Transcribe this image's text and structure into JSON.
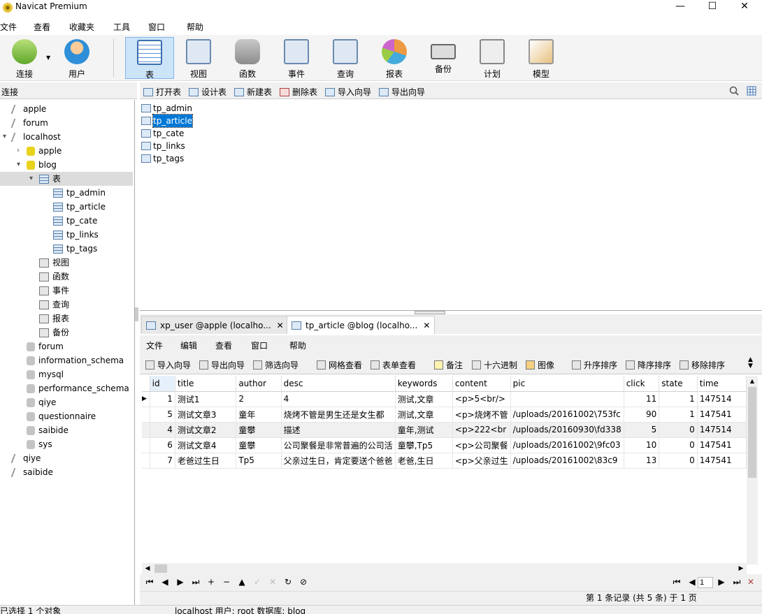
{
  "window": {
    "title": "Navicat Premium",
    "minimize": "—",
    "maximize": "☐",
    "close": "✕"
  },
  "menu": [
    "文件",
    "查看",
    "收藏夹",
    "工具",
    "窗口",
    "帮助"
  ],
  "toolbar": [
    {
      "label": "连接",
      "icon": "connect-icon"
    },
    {
      "label": "用户",
      "icon": "user-icon"
    },
    {
      "label": "表",
      "icon": "table-icon"
    },
    {
      "label": "视图",
      "icon": "view-icon"
    },
    {
      "label": "函数",
      "icon": "function-icon"
    },
    {
      "label": "事件",
      "icon": "event-icon"
    },
    {
      "label": "查询",
      "icon": "query-icon"
    },
    {
      "label": "报表",
      "icon": "report-icon"
    },
    {
      "label": "备份",
      "icon": "backup-icon"
    },
    {
      "label": "计划",
      "icon": "schedule-icon"
    },
    {
      "label": "模型",
      "icon": "model-icon"
    }
  ],
  "conn_header": "连接",
  "object_toolbar": [
    "打开表",
    "设计表",
    "新建表",
    "删除表",
    "导入向导",
    "导出向导"
  ],
  "tree": [
    {
      "label": "apple",
      "level": 0,
      "icon": "connection-icon"
    },
    {
      "label": "forum",
      "level": 0,
      "icon": "connection-icon"
    },
    {
      "label": "localhost",
      "level": 0,
      "icon": "connection-icon",
      "expanded": true
    },
    {
      "label": "apple",
      "level": 1,
      "icon": "database-icon",
      "collapsed": true
    },
    {
      "label": "blog",
      "level": 1,
      "icon": "database-icon",
      "expanded": true
    },
    {
      "label": "表",
      "level": 2,
      "icon": "tables-icon",
      "expanded": true,
      "selected": true
    },
    {
      "label": "tp_admin",
      "level": 3,
      "icon": "table-icon"
    },
    {
      "label": "tp_article",
      "level": 3,
      "icon": "table-icon"
    },
    {
      "label": "tp_cate",
      "level": 3,
      "icon": "table-icon"
    },
    {
      "label": "tp_links",
      "level": 3,
      "icon": "table-icon"
    },
    {
      "label": "tp_tags",
      "level": 3,
      "icon": "table-icon"
    },
    {
      "label": "视图",
      "level": 2,
      "icon": "view-icon"
    },
    {
      "label": "函数",
      "level": 2,
      "icon": "function-icon"
    },
    {
      "label": "事件",
      "level": 2,
      "icon": "event-icon"
    },
    {
      "label": "查询",
      "level": 2,
      "icon": "query-icon"
    },
    {
      "label": "报表",
      "level": 2,
      "icon": "report-icon"
    },
    {
      "label": "备份",
      "level": 2,
      "icon": "backup-icon"
    },
    {
      "label": "forum",
      "level": 1,
      "icon": "database-icon"
    },
    {
      "label": "information_schema",
      "level": 1,
      "icon": "database-icon"
    },
    {
      "label": "mysql",
      "level": 1,
      "icon": "database-icon"
    },
    {
      "label": "performance_schema",
      "level": 1,
      "icon": "database-icon"
    },
    {
      "label": "qiye",
      "level": 1,
      "icon": "database-icon"
    },
    {
      "label": "questionnaire",
      "level": 1,
      "icon": "database-icon"
    },
    {
      "label": "saibide",
      "level": 1,
      "icon": "database-icon"
    },
    {
      "label": "sys",
      "level": 1,
      "icon": "database-icon"
    },
    {
      "label": "qiye",
      "level": 0,
      "icon": "connection-icon"
    },
    {
      "label": "saibide",
      "level": 0,
      "icon": "connection-icon"
    }
  ],
  "object_list": [
    {
      "label": "tp_admin",
      "selected": false
    },
    {
      "label": "tp_article",
      "selected": true
    },
    {
      "label": "tp_cate",
      "selected": false
    },
    {
      "label": "tp_links",
      "selected": false
    },
    {
      "label": "tp_tags",
      "selected": false
    }
  ],
  "doc_tabs": [
    {
      "label": "xp_user @apple (localho...",
      "active": false
    },
    {
      "label": "tp_article @blog (localho...",
      "active": true
    }
  ],
  "doc_menu": [
    "文件",
    "编辑",
    "查看",
    "窗口",
    "帮助"
  ],
  "doc_tools": [
    "导入向导",
    "导出向导",
    "筛选向导",
    "网格查看",
    "表单查看",
    "备注",
    "十六进制",
    "图像",
    "升序排序",
    "降序排序",
    "移除排序"
  ],
  "grid": {
    "columns": [
      "id",
      "title",
      "author",
      "desc",
      "keywords",
      "content",
      "pic",
      "click",
      "state",
      "time"
    ],
    "rows": [
      [
        "1",
        "测试1",
        "2",
        "4",
        "测试,文章",
        "<p>5<br/>",
        "",
        "11",
        "1",
        "147514"
      ],
      [
        "5",
        "测试文章3",
        "童年",
        "烧烤不管是男生还是女生都",
        "测试,文章",
        "<p>烧烤不管",
        "/uploads/20161002\\753fc",
        "90",
        "1",
        "147541"
      ],
      [
        "4",
        "测试文章2",
        "童攀",
        "描述",
        "童年,测试",
        "<p>222<br",
        "/uploads/20160930\\fd338",
        "5",
        "0",
        "147514"
      ],
      [
        "6",
        "测试文章4",
        "童攀",
        "公司聚餐是非常普遍的公司活",
        "童攀,Tp5",
        "<p>公司聚餐",
        "/uploads/20161002\\9fc03",
        "10",
        "0",
        "147541"
      ],
      [
        "7",
        "老爸过生日",
        "Tp5",
        "父亲过生日，肯定要送个爸爸",
        "老爸,生日",
        "<p>父亲过生",
        "/uploads/20161002\\83c9",
        "13",
        "0",
        "147541"
      ]
    ]
  },
  "nav": {
    "page_value": "1"
  },
  "record_status": "第 1 条记录 (共 5 条) 于 1 页",
  "bottom_status": {
    "left": "已选择 1 个对象",
    "right": "localhost   用户: root   数据库: blog"
  }
}
